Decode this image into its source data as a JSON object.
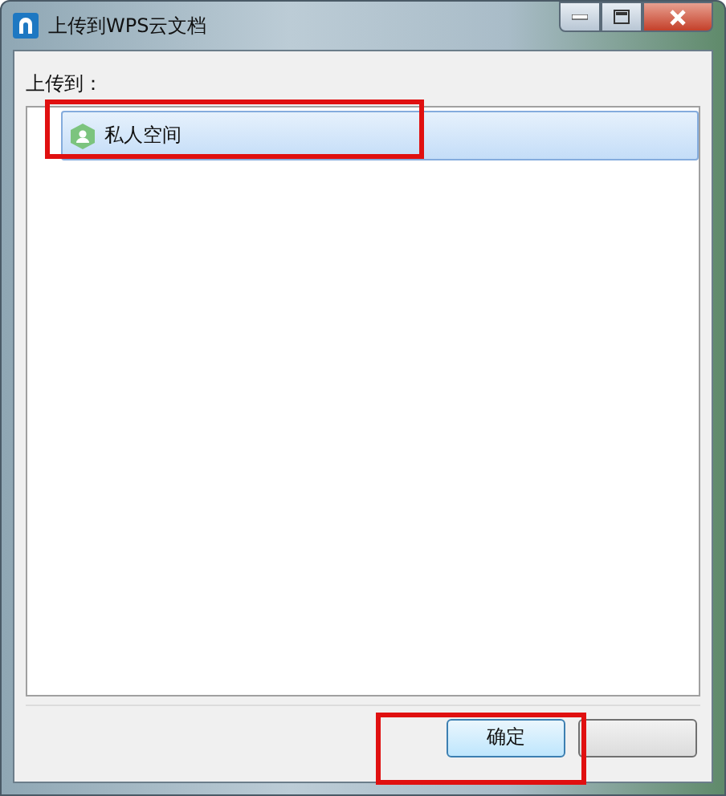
{
  "window": {
    "title": "上传到WPS云文档"
  },
  "label": "上传到：",
  "destinations": [
    {
      "name": "私人空间",
      "selected": true
    }
  ],
  "buttons": [
    {
      "label": "确定",
      "kind": "text"
    },
    {
      "kind": "blank"
    }
  ]
}
